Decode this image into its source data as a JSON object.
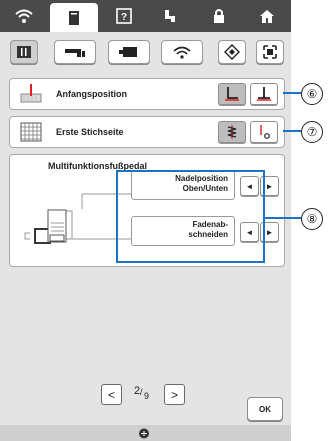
{
  "tabs": [
    {
      "icon": "wifi-icon"
    },
    {
      "icon": "document-icon"
    },
    {
      "icon": "help-icon"
    },
    {
      "icon": "embroidery-icon"
    },
    {
      "icon": "lock-icon"
    },
    {
      "icon": "home-icon"
    }
  ],
  "categories": [
    {
      "icon": "sewing-settings-icon"
    },
    {
      "icon": "sewing-machine-icon"
    },
    {
      "icon": "embroidery-frame-icon"
    },
    {
      "icon": "wifi-settings-icon"
    },
    {
      "icon": "diamond-icon"
    },
    {
      "icon": "frame-icon"
    }
  ],
  "rows": {
    "start_position": {
      "label": "Anfangsposition",
      "callout": "⑥"
    },
    "first_stitch": {
      "label": "Erste Stichseite",
      "callout": "⑦"
    }
  },
  "pedal": {
    "title": "Multifunktionsfußpedal",
    "needle_position_line1": "Nadelposition",
    "needle_position_line2": "Oben/Unten",
    "thread_cut_line1": "Fadenab-",
    "thread_cut_line2": "schneiden",
    "callout": "⑧",
    "left_arrow": "◄",
    "right_arrow": "►"
  },
  "pagination": {
    "prev": "<",
    "current": "2",
    "total": "9",
    "next": ">"
  },
  "ok_label": "OK",
  "colors": {
    "accent": "#1a73c8",
    "tabbar": "#4a4a4a",
    "screen_bg": "#e4e4e4"
  }
}
